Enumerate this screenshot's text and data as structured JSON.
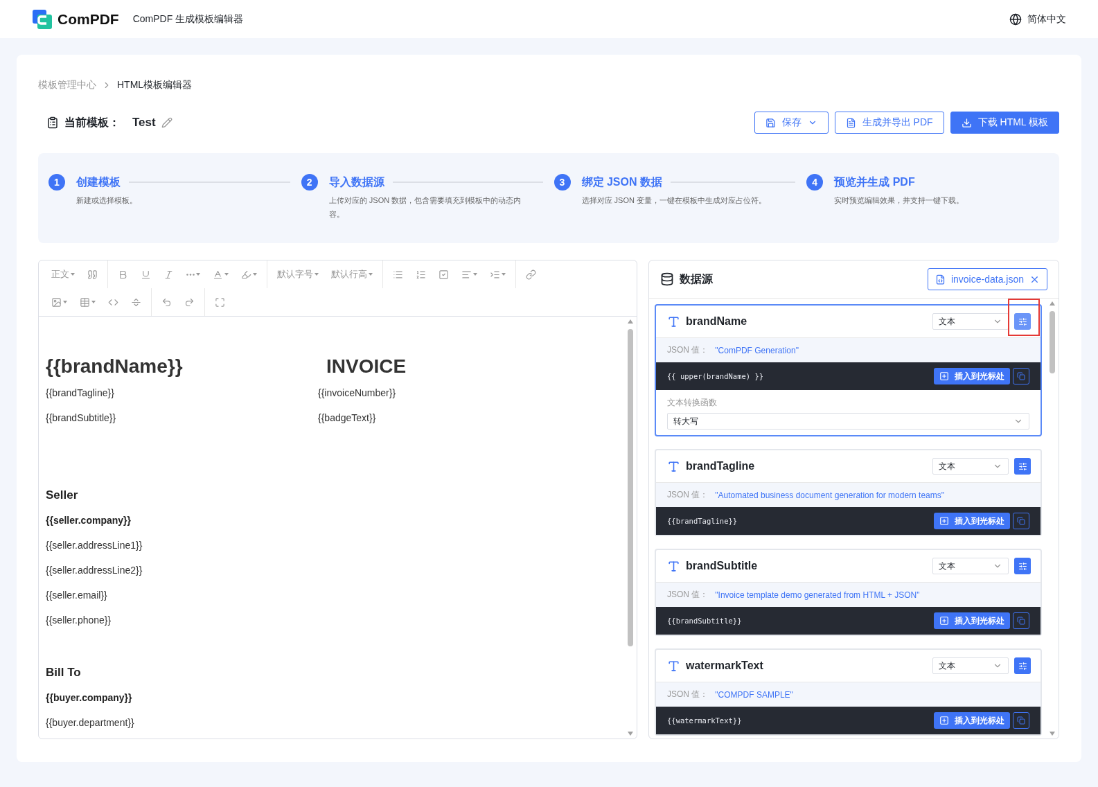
{
  "header": {
    "logo_text": "ComPDF",
    "app_title": "ComPDF 生成模板编辑器",
    "language": "简体中文"
  },
  "breadcrumb": [
    {
      "label": "模板管理中心",
      "current": false
    },
    {
      "label": "HTML模板编辑器",
      "current": true
    }
  ],
  "template": {
    "label": "当前模板：",
    "name": "Test"
  },
  "actions": [
    {
      "kind": "save",
      "label": "保存",
      "primary": false
    },
    {
      "kind": "pdf",
      "label": "生成并导出 PDF",
      "primary": false
    },
    {
      "kind": "download",
      "label": "下载 HTML 模板",
      "primary": true
    }
  ],
  "steps": [
    {
      "number": "1",
      "title": "创建模板",
      "description": "新建或选择模板。"
    },
    {
      "number": "2",
      "title": "导入数据源",
      "description": "上传对应的 JSON 数据，包含需要填充到模板中的动态内容。"
    },
    {
      "number": "3",
      "title": "绑定 JSON 数据",
      "description": "选择对应 JSON 变量，一键在模板中生成对应占位符。"
    },
    {
      "number": "4",
      "title": "预览并生成 PDF",
      "description": "实时预览编辑效果，并支持一键下载。"
    }
  ],
  "toolbar": [
    [
      [
        {
          "kind": "text",
          "label": "正文"
        },
        {
          "kind": "quote"
        }
      ],
      [
        {
          "kind": "bold"
        },
        {
          "kind": "underline"
        },
        {
          "kind": "italic"
        },
        {
          "kind": "more"
        },
        {
          "kind": "font-color"
        },
        {
          "kind": "bg-color"
        }
      ],
      [
        {
          "kind": "text",
          "label": "默认字号"
        },
        {
          "kind": "text",
          "label": "默认行高"
        }
      ],
      [
        {
          "kind": "bullet-list"
        },
        {
          "kind": "numbered-list"
        },
        {
          "kind": "todo"
        },
        {
          "kind": "align"
        },
        {
          "kind": "indent"
        }
      ],
      [
        {
          "kind": "link"
        }
      ]
    ],
    [
      [
        {
          "kind": "image"
        },
        {
          "kind": "table"
        },
        {
          "kind": "code"
        },
        {
          "kind": "divider"
        }
      ],
      [
        {
          "kind": "undo"
        },
        {
          "kind": "redo"
        }
      ],
      [
        {
          "kind": "fullscreen"
        }
      ]
    ]
  ],
  "document": {
    "columns": [
      [
        {
          "kind": "title",
          "text": "{{brandName}}"
        },
        {
          "kind": "text",
          "text": "{{brandTagline}}"
        },
        {
          "kind": "text",
          "text": "{{brandSubtitle}}"
        }
      ],
      [
        {
          "kind": "title",
          "text": "INVOICE"
        },
        {
          "kind": "text",
          "text": "{{invoiceNumber}}"
        },
        {
          "kind": "text",
          "text": "{{badgeText}}"
        }
      ]
    ],
    "body": [
      {
        "kind": "heading",
        "text": "Seller"
      },
      {
        "kind": "bold",
        "text": "{{seller.company}}"
      },
      {
        "kind": "text",
        "text": "{{seller.addressLine1}}"
      },
      {
        "kind": "text",
        "text": "{{seller.addressLine2}}"
      },
      {
        "kind": "text",
        "text": "{{seller.email}}"
      },
      {
        "kind": "text",
        "text": "{{seller.phone}}"
      },
      {
        "kind": "heading",
        "text": "Bill To"
      },
      {
        "kind": "bold",
        "text": "{{buyer.company}}"
      },
      {
        "kind": "text",
        "text": "{{buyer.department}}"
      }
    ]
  },
  "data_source": {
    "title": "数据源",
    "file": "invoice-data.json",
    "fields": [
      {
        "name": "brandName",
        "type": "文本",
        "value_label": "JSON 值：",
        "value": "\"ComPDF Generation\"",
        "expression": "{{ upper(brandName) }}",
        "insert_label": "插入到光标处",
        "selected": true,
        "highlighted": true,
        "transform": {
          "label": "文本转换函数",
          "value": "转大写"
        }
      },
      {
        "name": "brandTagline",
        "type": "文本",
        "value_label": "JSON 值：",
        "value": "\"Automated business document generation for modern teams\"",
        "expression": "{{brandTagline}}",
        "insert_label": "插入到光标处",
        "selected": false
      },
      {
        "name": "brandSubtitle",
        "type": "文本",
        "value_label": "JSON 值：",
        "value": "\"Invoice template demo generated from HTML + JSON\"",
        "expression": "{{brandSubtitle}}",
        "insert_label": "插入到光标处",
        "selected": false
      },
      {
        "name": "watermarkText",
        "type": "文本",
        "value_label": "JSON 值：",
        "value": "\"COMPDF SAMPLE\"",
        "expression": "{{watermarkText}}",
        "insert_label": "插入到光标处",
        "selected": false
      }
    ]
  }
}
